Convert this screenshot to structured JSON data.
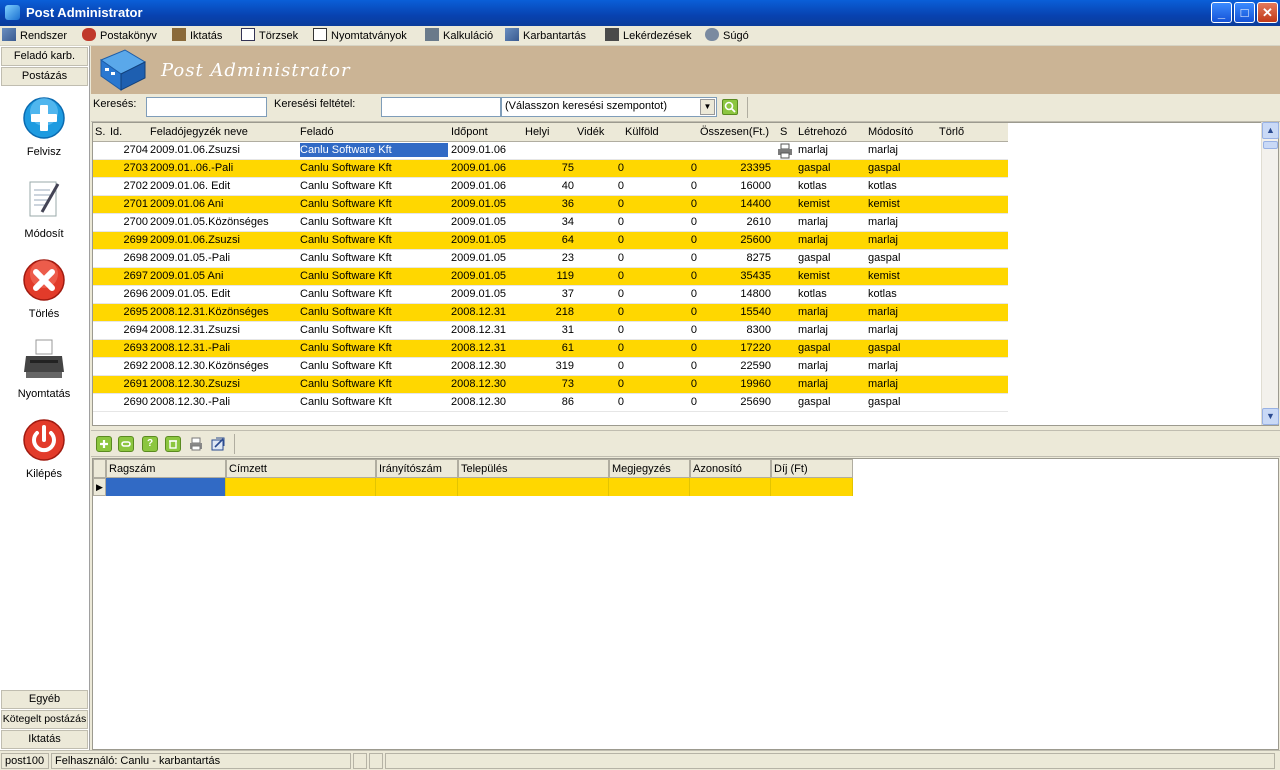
{
  "window": {
    "title": "Post Administrator"
  },
  "menu": [
    "Rendszer",
    "Postakönyv",
    "Iktatás",
    "Törzsek",
    "Nyomtatványok",
    "Kalkuláció",
    "Karbantartás",
    "Lekérdezések",
    "Súgó"
  ],
  "left_panel": {
    "tab_top_1": "Feladó karb.",
    "tab_top_2": "Postázás",
    "buttons": [
      "Felvisz",
      "Módosít",
      "Törlés",
      "Nyomtatás",
      "Kilépés"
    ],
    "tab_bottom_1": "Egyéb",
    "tab_bottom_2": "Kötegelt postázás",
    "tab_bottom_3": "Iktatás"
  },
  "banner": {
    "title": "Post Administrator"
  },
  "search": {
    "label": "Keresés:",
    "value": "",
    "criteria_label": "Keresési feltétel:",
    "criteria_value": "",
    "criteria_select": "(Válasszon keresési szempontot)"
  },
  "grid": {
    "headers": [
      "S.",
      "Id.",
      "Feladójegyzék neve",
      "Feladó",
      "Időpont",
      "Helyi",
      "Vidék",
      "Külföld",
      "Összesen(Ft.)",
      "S",
      "Létrehozó",
      "Módosító",
      "Törlő"
    ],
    "rows": [
      {
        "id": "2704",
        "name": "2009.01.06.Zsuzsi",
        "sender": "Canlu Software Kft",
        "date": "2009.01.06",
        "local": "",
        "region": "",
        "abroad": "",
        "total": "",
        "creator": "marlaj",
        "modifier": "marlaj",
        "deleter": "",
        "selected": true
      },
      {
        "id": "2703",
        "name": "2009.01..06.-Pali",
        "sender": "Canlu Software Kft",
        "date": "2009.01.06",
        "local": "75",
        "region": "0",
        "abroad": "0",
        "total": "23395",
        "creator": "gaspal",
        "modifier": "gaspal",
        "deleter": ""
      },
      {
        "id": "2702",
        "name": "2009.01.06. Edit",
        "sender": "Canlu Software Kft",
        "date": "2009.01.06",
        "local": "40",
        "region": "0",
        "abroad": "0",
        "total": "16000",
        "creator": "kotlas",
        "modifier": "kotlas",
        "deleter": ""
      },
      {
        "id": "2701",
        "name": "2009.01.06 Ani",
        "sender": "Canlu Software Kft",
        "date": "2009.01.05",
        "local": "36",
        "region": "0",
        "abroad": "0",
        "total": "14400",
        "creator": "kemist",
        "modifier": "kemist",
        "deleter": ""
      },
      {
        "id": "2700",
        "name": "2009.01.05.Közönséges",
        "sender": "Canlu Software Kft",
        "date": "2009.01.05",
        "local": "34",
        "region": "0",
        "abroad": "0",
        "total": "2610",
        "creator": "marlaj",
        "modifier": "marlaj",
        "deleter": ""
      },
      {
        "id": "2699",
        "name": "2009.01.06.Zsuzsi",
        "sender": "Canlu Software Kft",
        "date": "2009.01.05",
        "local": "64",
        "region": "0",
        "abroad": "0",
        "total": "25600",
        "creator": "marlaj",
        "modifier": "marlaj",
        "deleter": ""
      },
      {
        "id": "2698",
        "name": "2009.01.05.-Pali",
        "sender": "Canlu Software Kft",
        "date": "2009.01.05",
        "local": "23",
        "region": "0",
        "abroad": "0",
        "total": "8275",
        "creator": "gaspal",
        "modifier": "gaspal",
        "deleter": ""
      },
      {
        "id": "2697",
        "name": "2009.01.05 Ani",
        "sender": "Canlu Software Kft",
        "date": "2009.01.05",
        "local": "119",
        "region": "0",
        "abroad": "0",
        "total": "35435",
        "creator": "kemist",
        "modifier": "kemist",
        "deleter": ""
      },
      {
        "id": "2696",
        "name": "2009.01.05. Edit",
        "sender": "Canlu Software Kft",
        "date": "2009.01.05",
        "local": "37",
        "region": "0",
        "abroad": "0",
        "total": "14800",
        "creator": "kotlas",
        "modifier": "kotlas",
        "deleter": ""
      },
      {
        "id": "2695",
        "name": "2008.12.31.Közönséges",
        "sender": "Canlu Software Kft",
        "date": "2008.12.31",
        "local": "218",
        "region": "0",
        "abroad": "0",
        "total": "15540",
        "creator": "marlaj",
        "modifier": "marlaj",
        "deleter": ""
      },
      {
        "id": "2694",
        "name": "2008.12.31.Zsuzsi",
        "sender": "Canlu Software Kft",
        "date": "2008.12.31",
        "local": "31",
        "region": "0",
        "abroad": "0",
        "total": "8300",
        "creator": "marlaj",
        "modifier": "marlaj",
        "deleter": ""
      },
      {
        "id": "2693",
        "name": "2008.12.31.-Pali",
        "sender": "Canlu Software Kft",
        "date": "2008.12.31",
        "local": "61",
        "region": "0",
        "abroad": "0",
        "total": "17220",
        "creator": "gaspal",
        "modifier": "gaspal",
        "deleter": ""
      },
      {
        "id": "2692",
        "name": "2008.12.30.Közönséges",
        "sender": "Canlu Software Kft",
        "date": "2008.12.30",
        "local": "319",
        "region": "0",
        "abroad": "0",
        "total": "22590",
        "creator": "marlaj",
        "modifier": "marlaj",
        "deleter": ""
      },
      {
        "id": "2691",
        "name": "2008.12.30.Zsuzsi",
        "sender": "Canlu Software Kft",
        "date": "2008.12.30",
        "local": "73",
        "region": "0",
        "abroad": "0",
        "total": "19960",
        "creator": "marlaj",
        "modifier": "marlaj",
        "deleter": ""
      },
      {
        "id": "2690",
        "name": "2008.12.30.-Pali",
        "sender": "Canlu Software Kft",
        "date": "2008.12.30",
        "local": "86",
        "region": "0",
        "abroad": "0",
        "total": "25690",
        "creator": "gaspal",
        "modifier": "gaspal",
        "deleter": ""
      }
    ]
  },
  "detail_grid": {
    "headers": [
      "Ragszám",
      "Címzett",
      "Irányítószám",
      "Település",
      "Megjegyzés",
      "Azonosító",
      "Díj (Ft)"
    ]
  },
  "statusbar": {
    "left": "post100",
    "user": "Felhasználó: Canlu - karbantartás"
  },
  "colors": {
    "row_highlight": "#ffd700",
    "selection": "#316ac5",
    "banner": "#cbb495"
  }
}
